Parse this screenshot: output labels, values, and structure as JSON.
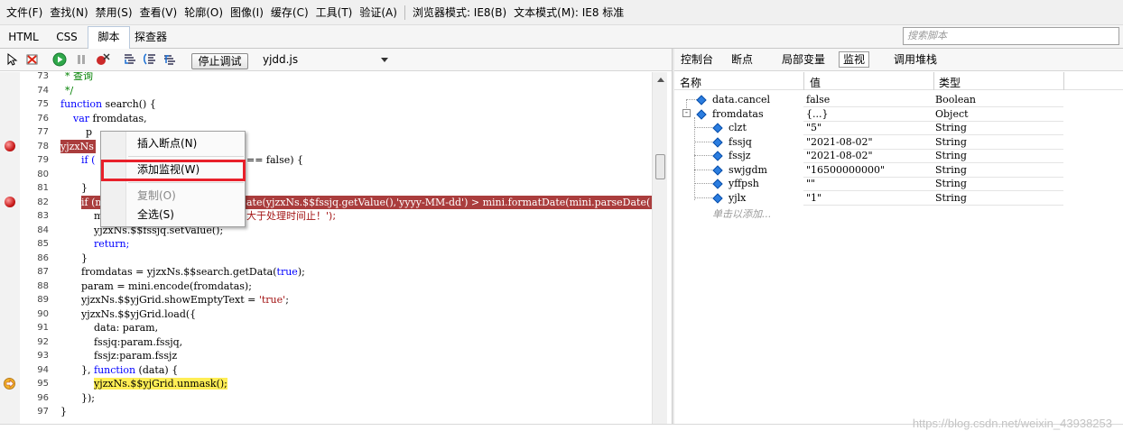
{
  "menubar": {
    "items": [
      "文件(F)",
      "查找(N)",
      "禁用(S)",
      "查看(V)",
      "轮廓(O)",
      "图像(I)",
      "缓存(C)",
      "工具(T)",
      "验证(A)"
    ],
    "browser_mode": "浏览器模式: IE8(B)",
    "doc_mode": "文本模式(M): IE8 标准"
  },
  "tabs": [
    "HTML",
    "CSS",
    "脚本",
    "探查器"
  ],
  "active_tab": "脚本",
  "search": {
    "placeholder": "搜索脚本"
  },
  "toolbar": {
    "stop_debug_label": "停止调试",
    "file": "yjdd.js"
  },
  "code_lines": [
    {
      "n": "73",
      "text": "* 查询"
    },
    {
      "n": "74",
      "text": "*/"
    },
    {
      "n": "75",
      "text": "function search() {"
    },
    {
      "n": "76",
      "text": "    var fromdatas,"
    },
    {
      "n": "77",
      "text": "        p"
    },
    {
      "n": "78",
      "text": "yjzxNs"
    },
    {
      "n": "79",
      "text": "if ("
    },
    {
      "n": "80",
      "text": "    "
    },
    {
      "n": "81",
      "text": "}"
    },
    {
      "n": "82",
      "text": "if (m"
    },
    {
      "n": "83",
      "text": "    m"
    },
    {
      "n": "84",
      "text": "    yjzxNs.$$fssjq.setValue();"
    },
    {
      "n": "85",
      "text": "    return;"
    },
    {
      "n": "86",
      "text": "}"
    },
    {
      "n": "87",
      "text": "fromdatas = yjzxNs.$$search.getData(true);"
    },
    {
      "n": "88",
      "text": "param = mini.encode(fromdatas);"
    },
    {
      "n": "89",
      "text": "yjzxNs.$$yjGrid.showEmptyText = 'true';"
    },
    {
      "n": "90",
      "text": "yjzxNs.$$yjGrid.load({"
    },
    {
      "n": "91",
      "text": "    data: param,"
    },
    {
      "n": "92",
      "text": "    fssjq:param.fssjq,"
    },
    {
      "n": "93",
      "text": "    fssjz:param.fssjz"
    },
    {
      "n": "94",
      "text": "}, function (data) {"
    },
    {
      "n": "95",
      "text": "    yjzxNs.$$yjGrid.unmask();"
    },
    {
      "n": "96",
      "text": "});"
    },
    {
      "n": "97",
      "text": "}"
    }
  ],
  "code_fragments": {
    "line79_tail": "== false) {",
    "line82_tail": "ate(yjzxNs.$$fssjq.getValue(),'yyyy-MM-dd') > mini.formatDate(mini.parseDate(",
    "line83_tail": "大于处理时间止！');"
  },
  "context_menu": {
    "items": [
      "插入断点(N)",
      "添加监视(W)",
      "复制(O)",
      "全选(S)"
    ],
    "disabled": [
      "复制(O)"
    ],
    "highlighted": "添加监视(W)"
  },
  "right_tabs": [
    "控制台",
    "断点",
    "局部变量",
    "监视",
    "调用堆栈"
  ],
  "right_active": "监视",
  "watch": {
    "headers": [
      "名称",
      "值",
      "类型"
    ],
    "rows": [
      {
        "name": "data.cancel",
        "value": "false",
        "type": "Boolean"
      },
      {
        "name": "fromdatas",
        "value": "{...}",
        "type": "Object"
      },
      {
        "name": "clzt",
        "value": "\"5\"",
        "type": "String"
      },
      {
        "name": "fssjq",
        "value": "\"2021-08-02\"",
        "type": "String"
      },
      {
        "name": "fssjz",
        "value": "\"2021-08-02\"",
        "type": "String"
      },
      {
        "name": "swjgdm",
        "value": "\"16500000000\"",
        "type": "String"
      },
      {
        "name": "yffpsh",
        "value": "\"\"",
        "type": "String"
      },
      {
        "name": "yjlx",
        "value": "\"1\"",
        "type": "String"
      }
    ],
    "add_hint": "单击以添加..."
  },
  "watermark": "https://blog.csdn.net/weixin_43938253",
  "colors": {
    "breakpoint_line": "#aa3d3d",
    "current_line": "#ffee55",
    "highlight_box": "#e8202a"
  }
}
